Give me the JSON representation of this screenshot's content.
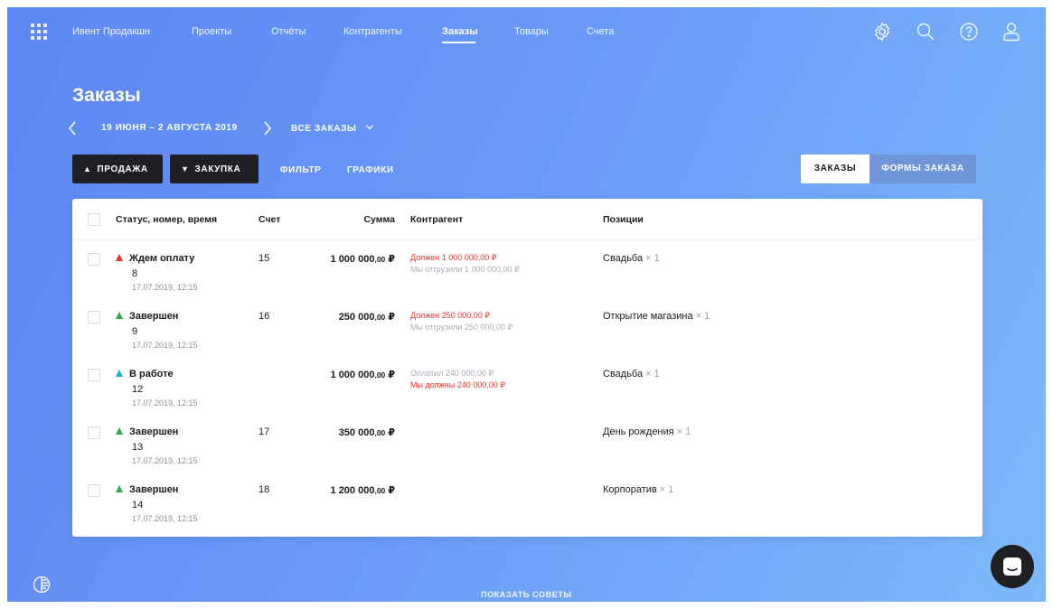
{
  "nav": {
    "items": [
      {
        "label": "Ивент Продакшн",
        "active": false
      },
      {
        "label": "Проекты",
        "active": false
      },
      {
        "label": "Отчёты",
        "active": false
      },
      {
        "label": "Контрагенты",
        "active": false
      },
      {
        "label": "Заказы",
        "active": true
      },
      {
        "label": "Товары",
        "active": false
      },
      {
        "label": "Счета",
        "active": false
      }
    ],
    "icons": [
      "apps-grid-icon",
      "settings-gear-icon",
      "search-icon",
      "help-icon",
      "user-icon"
    ]
  },
  "header": {
    "title": "Заказы",
    "period": "19 ИЮНЯ – 2 АВГУСТА 2019",
    "filter": "ВСЕ ЗАКАЗЫ"
  },
  "toolbar": {
    "sale": "ПРОДАЖА",
    "purchase": "ЗАКУПКА",
    "filter": "ФИЛЬТР",
    "charts": "ГРАФИКИ",
    "tab_orders": "ЗАКАЗЫ",
    "tab_forms": "ФОРМЫ ЗАКАЗА"
  },
  "table": {
    "columns": {
      "status": "Статус, номер, время",
      "invoice": "Счет",
      "sum": "Сумма",
      "counterparty": "Контрагент",
      "positions": "Позиции"
    },
    "rows": [
      {
        "status": "Ждем оплату",
        "status_color": "#e5322d",
        "number": "8",
        "datetime": "17.07.2019, 12:15",
        "invoice": "15",
        "sum_main": "1 000 000",
        "sum_kop": ",00",
        "currency": "₽",
        "cp_line1": "Должен 1 000 000,00 ₽",
        "cp_line1_color": "red",
        "cp_line2": "Мы отгрузили 1 000 000,00 ₽",
        "cp_line2_color": "grey",
        "position": "Свадьба",
        "qty": "× 1"
      },
      {
        "status": "Завершен",
        "status_color": "#2fa84f",
        "number": "9",
        "datetime": "17.07.2019, 12:15",
        "invoice": "16",
        "sum_main": "250 000",
        "sum_kop": ",00",
        "currency": "₽",
        "cp_line1": "Должен 250 000,00 ₽",
        "cp_line1_color": "red",
        "cp_line2": "Мы отгрузили 250 000,00 ₽",
        "cp_line2_color": "grey",
        "position": "Открытие магазина",
        "qty": "× 1"
      },
      {
        "status": "В работе",
        "status_color": "#17b3c7",
        "number": "12",
        "datetime": "17.07.2019, 12:15",
        "invoice": "",
        "sum_main": "1 000 000",
        "sum_kop": ",00",
        "currency": "₽",
        "cp_line1": "Оплатил 240 000,00 ₽",
        "cp_line1_color": "grey",
        "cp_line2": "Мы должны 240 000,00 ₽",
        "cp_line2_color": "red",
        "position": "Свадьба",
        "qty": "× 1"
      },
      {
        "status": "Завершен",
        "status_color": "#2fa84f",
        "number": "13",
        "datetime": "17.07.2019, 12:15",
        "invoice": "17",
        "sum_main": "350 000",
        "sum_kop": ",00",
        "currency": "₽",
        "cp_line1": "",
        "cp_line1_color": "red",
        "cp_line2": "",
        "cp_line2_color": "grey",
        "position": "День рождения",
        "qty": "× 1"
      },
      {
        "status": "Завершен",
        "status_color": "#2fa84f",
        "number": "14",
        "datetime": "17.07.2019, 12:15",
        "invoice": "18",
        "sum_main": "1 200 000",
        "sum_kop": ",00",
        "currency": "₽",
        "cp_line1": "",
        "cp_line1_color": "red",
        "cp_line2": "",
        "cp_line2_color": "grey",
        "position": "Корпоратив",
        "qty": "× 1"
      }
    ]
  },
  "footer": {
    "tips": "ПОКАЗАТЬ СОВЕТЫ"
  }
}
